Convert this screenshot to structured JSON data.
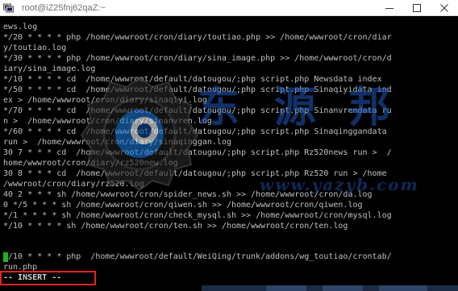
{
  "window": {
    "title": "root@iZ25fnj62qaZ:~",
    "app_icon": "putty-icon",
    "controls": [
      "minimize-icon",
      "maximize-icon",
      "close-icon"
    ]
  },
  "terminal": {
    "lines": [
      "ews.log",
      "*/20 * * * * php /home/wwwroot/cron/diary/toutiao.php >> /home/wwwroot/cron/diar",
      "y/toutiao.log",
      "*/30 * * * * php /home/wwwroot/cron/diary/sina_image.php >> /home/wwwroot/cron/d",
      "iary/sina_image.log",
      "*/10 * * * * cd  /home/wwwroot/default/datougou/;php script.php Newsdata index",
      "*/50 * * * * cd  /home/wwwroot/default/datougou/;php script.php Sinaqiyidata ind",
      "ex > /home/wwwroot/cron/diary/sinaqiyi.log",
      "*/70 * * * * cd  /home/wwwroot/default/datougou/;php script.php Sinanvrendata ru",
      "n >  /home/wwwroot/cron/diary/sinanvren.log",
      "*/60 * * * * cd  /home/wwwroot/default/datougou/;php script.php Sinaqinggandata",
      "run >  /home/wwwroot/cron/diary/sinaqinggan.log",
      "30 7 * * * cd  /home/wwwroot/default/datougou/;php script.php Rz520news run >  /",
      "home/wwwroot/cron/diary/rz520new.log",
      "30 8 * * * cd  /home/wwwroot/default/datougou/;php script.php Rz520 run > /home",
      "/wwwroot/cron/diary/rz520.log",
      "40 2 * * * sh /home/wwwroot/cron/spider_news.sh >> /home/wwwroot/cron/da.log",
      "0 */5 * * * sh /home/wwwroot/cron/qiwen.sh >> /home/wwwroot/cron/qiwen.log",
      "*/1 * * * * sh /home/wwwroot/cron/check_mysql.sh >> /home/wwwroot/cron/mysql.log",
      "*/10 * * * * sh /home/wwwroot/cron/ten.sh >> /home/wwwroot/cron/ten.log",
      "/10 * * * * php  /home/wwwroot/default/WeiQing/trunk/addons/wg_toutiao/crontab/",
      "run.php"
    ],
    "cursor_color": "#1db31d",
    "mode_line": "-- INSERT --"
  },
  "watermark": {
    "logo": "watermark-logo-icon",
    "url": "www.yazyb.com"
  },
  "colors": {
    "terminal_bg": "#000000",
    "terminal_fg": "#c0c0c0",
    "highlight_box": "#e2231a",
    "watermark": "#1e5abe"
  }
}
